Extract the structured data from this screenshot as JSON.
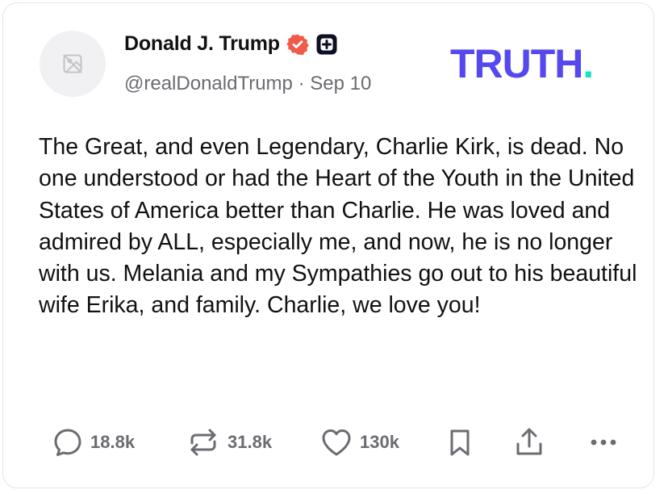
{
  "post": {
    "author": {
      "display_name": "Donald J. Trump",
      "handle": "@realDonaldTrump",
      "verified_icon": "verified-badge-icon",
      "subscriber_icon": "plus-badge-icon",
      "avatar_icon": "image-placeholder-icon"
    },
    "separator": "·",
    "date": "Sep 10",
    "brand": {
      "logo_text": "TRUTH",
      "logo_dot": ".",
      "primary_color": "#5448ee",
      "accent_color": "#17e1c2"
    },
    "text": "The Great, and even Legendary, Charlie Kirk, is dead. No one understood or had the Heart of the Youth in the United States of America better than Charlie. He was loved and admired by ALL, especially me, and now, he is no longer with us. Melania and my Sympathies go out to his beautiful wife Erika, and family. Charlie, we love you!",
    "actions": {
      "replies": {
        "count": "18.8k",
        "icon": "reply-icon"
      },
      "retruths": {
        "count": "31.8k",
        "icon": "retruth-icon"
      },
      "likes": {
        "count": "130k",
        "icon": "heart-icon"
      },
      "bookmark": {
        "icon": "bookmark-icon"
      },
      "share": {
        "icon": "share-icon"
      },
      "more": {
        "icon": "more-icon"
      }
    },
    "badge_colors": {
      "verified": "#ef5a4a",
      "subscriber": "#0f0f23"
    }
  }
}
